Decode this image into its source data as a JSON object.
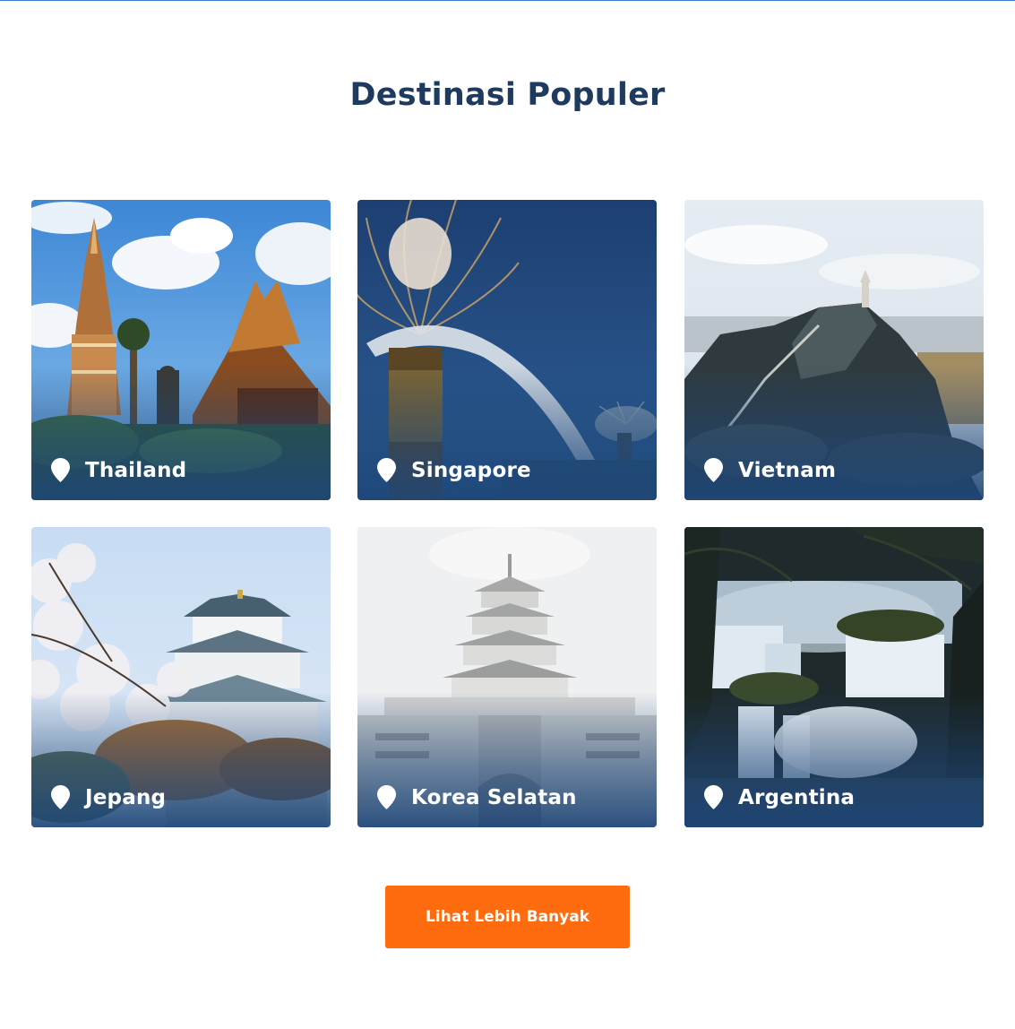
{
  "section": {
    "title": "Destinasi Populer"
  },
  "destinations": [
    {
      "name": "Thailand",
      "icon": "location-pin-icon"
    },
    {
      "name": "Singapore",
      "icon": "location-pin-icon"
    },
    {
      "name": "Vietnam",
      "icon": "location-pin-icon"
    },
    {
      "name": "Jepang",
      "icon": "location-pin-icon"
    },
    {
      "name": "Korea Selatan",
      "icon": "location-pin-icon"
    },
    {
      "name": "Argentina",
      "icon": "location-pin-icon"
    }
  ],
  "cta": {
    "label": "Lihat Lebih Banyak"
  },
  "colors": {
    "title": "#1e3a5f",
    "button": "#ff6c0f",
    "overlay": "#1e4678",
    "topline": "#3a7bd5"
  }
}
